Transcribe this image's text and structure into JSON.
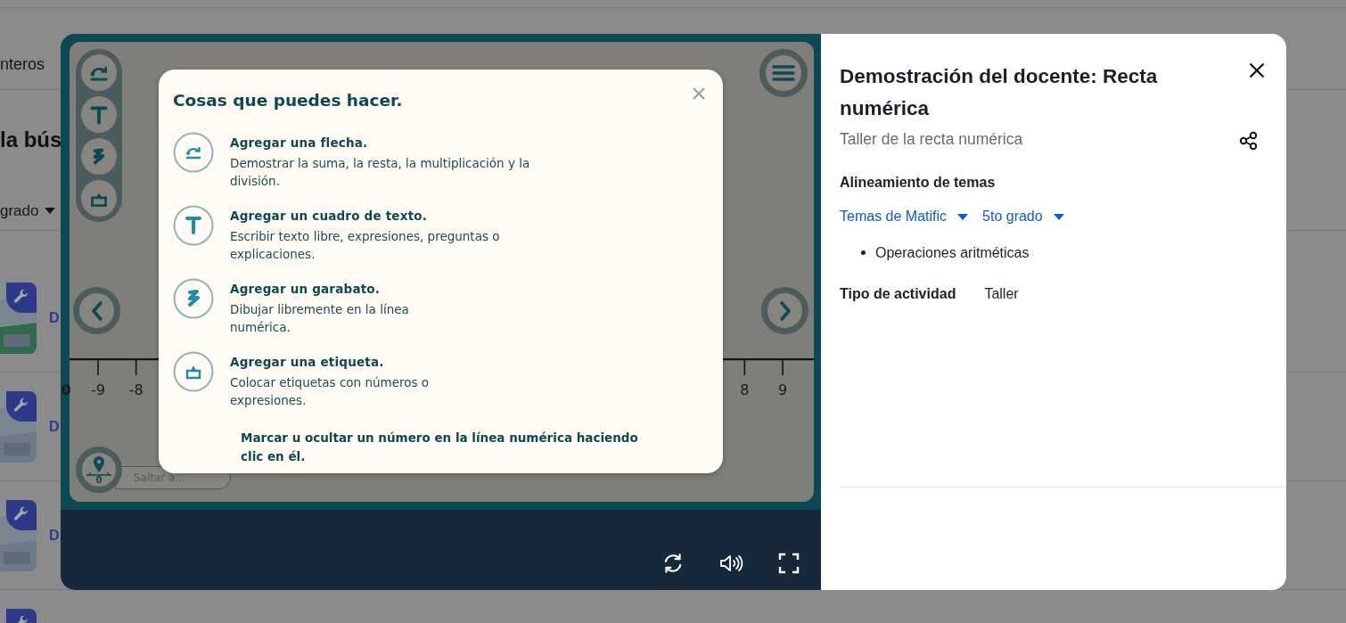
{
  "background_page": {
    "breadcrumb": "nteros",
    "heading": "la bús",
    "filter": "grado",
    "rows": [
      {
        "kind": "picture",
        "link": "D"
      },
      {
        "kind": "picture",
        "link": "D"
      },
      {
        "kind": "picture",
        "link": "D"
      },
      {
        "kind": "picture"
      }
    ]
  },
  "modal": {
    "game": {
      "tools": [
        {
          "kind": "arrow"
        },
        {
          "kind": "text"
        },
        {
          "kind": "scribble"
        },
        {
          "kind": "label"
        }
      ],
      "cut_tick_label": "0",
      "tick_labels": [
        "-9",
        "-8",
        "8",
        "9"
      ],
      "jump_marker": "0",
      "jump_field": {
        "placeholder": "Saltar a..."
      },
      "popup": {
        "title": "Cosas que puedes hacer.",
        "items": [
          {
            "kind": "arrow",
            "title": "Agregar una flecha.",
            "description": "Demostrar la suma, la resta, la multiplicación y la división."
          },
          {
            "kind": "text",
            "title": "Agregar un cuadro de texto.",
            "description": "Escribir texto libre, expresiones, preguntas o explicaciones."
          },
          {
            "kind": "scribble",
            "title": "Agregar un garabato.",
            "description": "Dibujar libremente en la línea numérica."
          },
          {
            "kind": "label",
            "title": "Agregar una etiqueta.",
            "description": "Colocar etiquetas con números o expresiones."
          }
        ],
        "note": "Marcar u ocultar un número en la línea numérica haciendo clic en él."
      },
      "controls": [
        {
          "kind": "restart"
        },
        {
          "kind": "sound"
        },
        {
          "kind": "fullscreen"
        }
      ]
    },
    "details": {
      "title": "Demostración del docente: Recta numérica",
      "subtitle": "Taller de la recta numérica",
      "alignment_heading": "Alineamiento de temas",
      "dropdowns": [
        "Temas de Matific",
        "5to grado"
      ],
      "topics": [
        "Operaciones aritméticas"
      ],
      "activity_type": {
        "label": "Tipo de actividad",
        "value": "Taller"
      }
    }
  }
}
